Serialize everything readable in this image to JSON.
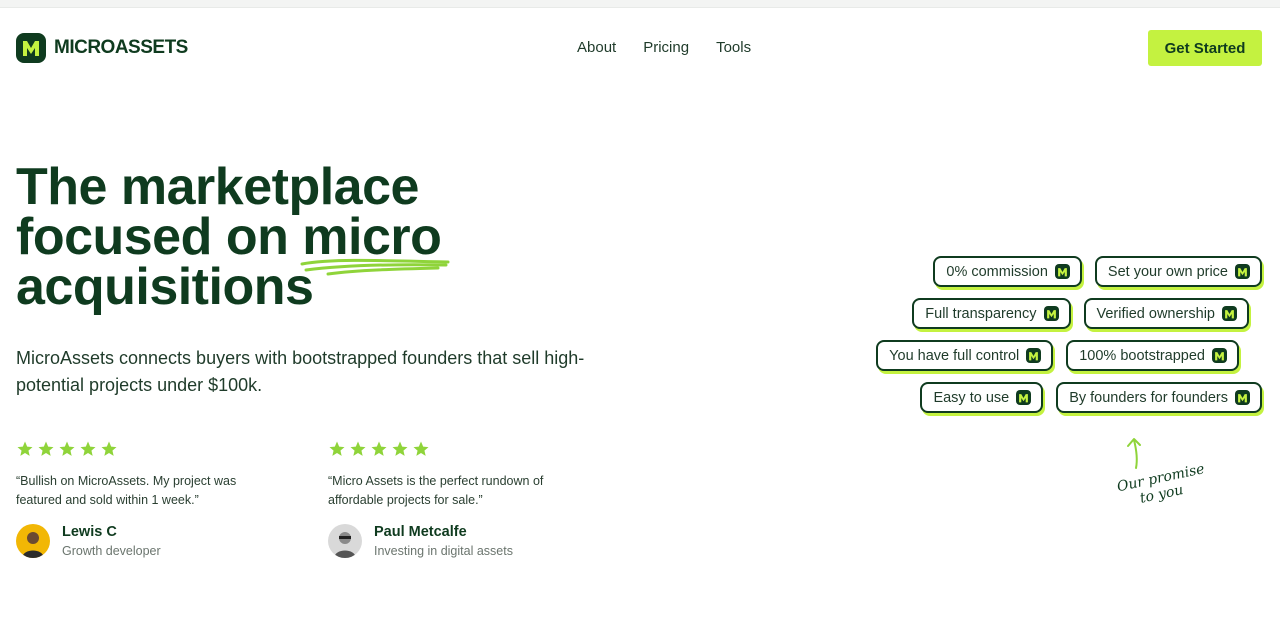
{
  "brand": {
    "name": "MICROASSETS",
    "accent": "#c4f240",
    "dark": "#0f3b1f"
  },
  "nav": {
    "items": [
      "About",
      "Pricing",
      "Tools"
    ]
  },
  "cta": {
    "label": "Get Started"
  },
  "hero": {
    "line1": "The marketplace",
    "line2_prefix": "focused on ",
    "line2_highlight": "micro",
    "line3": "acquisitions",
    "subtitle": "MicroAssets connects buyers with bootstrapped founders that sell high-potential projects under $100k."
  },
  "reviews": [
    {
      "rating": 5,
      "quote": "“Bullish on MicroAssets. My project was featured and sold within 1 week.”",
      "name": "Lewis C",
      "role": "Growth developer"
    },
    {
      "rating": 5,
      "quote": "“Micro Assets is the perfect rundown of affordable projects for sale.”",
      "name": "Paul Metcalfe",
      "role": "Investing in digital assets"
    }
  ],
  "chips": [
    [
      "0% commission",
      "Set your own price"
    ],
    [
      "Full transparency",
      "Verified ownership"
    ],
    [
      "You have full control",
      "100% bootstrapped"
    ],
    [
      "Easy to use",
      "By founders for founders"
    ]
  ],
  "promise": {
    "line1": "Our promise",
    "line2": "to you"
  }
}
